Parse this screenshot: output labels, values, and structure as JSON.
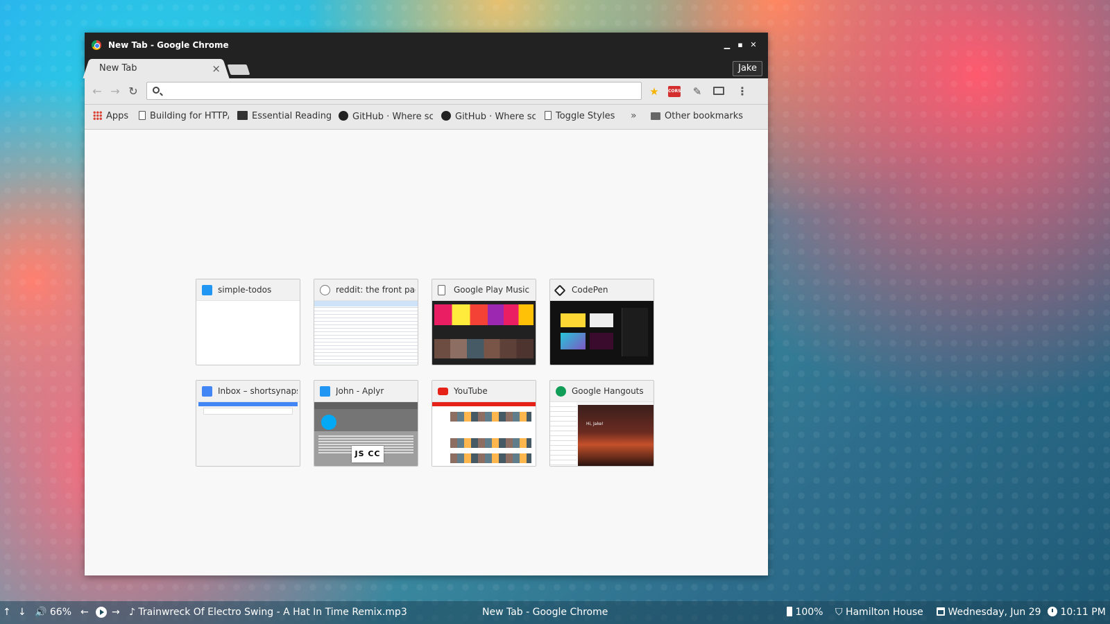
{
  "window": {
    "title": "New Tab - Google Chrome",
    "min_glyph": "▁",
    "max_glyph": "▪",
    "close_glyph": "✕"
  },
  "tab": {
    "label": "New Tab",
    "close_glyph": "×"
  },
  "profile": {
    "name": "Jake"
  },
  "toolbar": {
    "back_glyph": "←",
    "forward_glyph": "→",
    "reload_glyph": "↻",
    "omnibox_value": "",
    "omnibox_placeholder": "",
    "star_glyph": "★",
    "cors_label": "CORS",
    "dropper_glyph": "✎",
    "menu_glyph": "⋮"
  },
  "bookmarks": {
    "items": [
      {
        "label": "Apps",
        "icon": "apps-grid-icon"
      },
      {
        "label": "Building for HTTP/",
        "icon": "page-icon"
      },
      {
        "label": "Essential Reading",
        "icon": "sketch-icon"
      },
      {
        "label": "GitHub · Where sc",
        "icon": "github-icon"
      },
      {
        "label": "GitHub · Where sc",
        "icon": "github-icon"
      },
      {
        "label": "Toggle Styles",
        "icon": "page-icon"
      }
    ],
    "more_glyph": "»",
    "other": "Other bookmarks"
  },
  "most_visited": [
    {
      "title": "simple-todos",
      "icon": "aplyr-icon"
    },
    {
      "title": "reddit: the front page of",
      "icon": "reddit-icon"
    },
    {
      "title": "Google Play Music",
      "icon": "page-icon"
    },
    {
      "title": "CodePen",
      "icon": "codepen-icon"
    },
    {
      "title": "Inbox – shortsynapse@",
      "icon": "inbox-icon"
    },
    {
      "title": "John - Aplyr",
      "icon": "aplyr-icon",
      "badge": "JS CC"
    },
    {
      "title": "YouTube",
      "icon": "youtube-icon"
    },
    {
      "title": "Google Hangouts",
      "icon": "hangouts-icon",
      "thumb_text": "Hi, Jake!"
    }
  ],
  "taskbar": {
    "up_glyph": "↑",
    "down_glyph": "↓",
    "volume_glyph": "🔊",
    "volume": "66%",
    "prev_glyph": "←",
    "next_glyph": "→",
    "note_glyph": "♪",
    "track": "Trainwreck Of Electro Swing - A Hat In Time Remix.mp3",
    "active_window": "New Tab - Google Chrome",
    "battery": "100%",
    "location_glyph": "⛉",
    "location": "Hamilton House",
    "date": "Wednesday, Jun 29",
    "time": "10:11 PM"
  }
}
